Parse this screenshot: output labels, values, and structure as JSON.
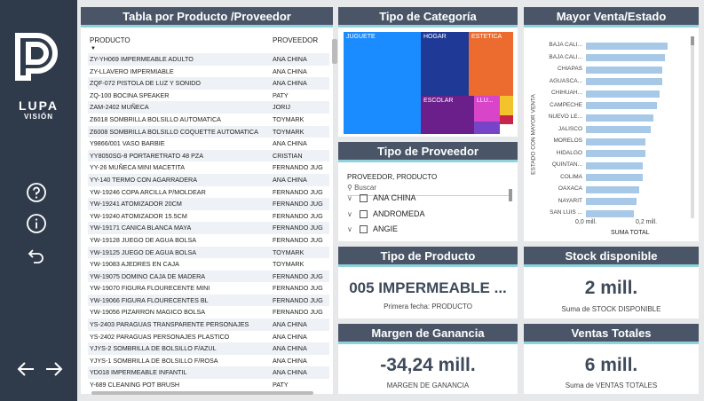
{
  "brand": {
    "line1": "LUPA",
    "line2": "VISIÓN"
  },
  "nav": {
    "help_icon": "question-circle-icon",
    "info_icon": "info-circle-icon",
    "back_icon": "undo-icon"
  },
  "table": {
    "title": "Tabla por Producto /Proveedor",
    "col_producto": "PRODUCTO",
    "col_proveedor": "PROVEEDOR",
    "rows": [
      [
        "ZY-YH069 IMPERMEABLE ADULTO",
        "ANA CHINA"
      ],
      [
        "ZY-LLAVERO IMPERMIABLE",
        "ANA CHINA"
      ],
      [
        "ZQF-072 PISTOLA DE LUZ Y SONIDO",
        "ANA CHINA"
      ],
      [
        "ZQ-100 BOCINA SPEAKER",
        "PATY"
      ],
      [
        "ZAM-2402 MUÑECA",
        "JORIJ"
      ],
      [
        "Z6018 SOMBRILLA BOLSILLO AUTOMATICA",
        "TOYMARK"
      ],
      [
        "Z6008 SOMBRILLA BOLSILLO COQUETTE AUTOMATICA",
        "TOYMARK"
      ],
      [
        "Y9866/001 VASO BARBIE",
        "ANA CHINA"
      ],
      [
        "YY8050SG-8 PORTARETRATO 48 PZA",
        "CRISTIAN"
      ],
      [
        "YY-26 MUÑECA MINI MACETITA",
        "FERNANDO JUG"
      ],
      [
        "YY-140 TERMO CON AGARRADERA",
        "ANA CHINA"
      ],
      [
        "YW-19246 COPA ARCILLA P/MOLDEAR",
        "FERNANDO JUG"
      ],
      [
        "YW-19241 ATOMIZADOR 20CM",
        "FERNANDO JUG"
      ],
      [
        "YW-19240 ATOMIZADOR 15.5CM",
        "FERNANDO JUG"
      ],
      [
        "YW-19171 CANICA BLANCA MAYA",
        "FERNANDO JUG"
      ],
      [
        "YW-19128 JUEGO DE AGUA BOLSA",
        "FERNANDO JUG"
      ],
      [
        "YW-19125 JUEGO DE AGUA BOLSA",
        "TOYMARK"
      ],
      [
        "YW-19083 AJEDRES EN CAJA",
        "TOYMARK"
      ],
      [
        "YW-19075 DOMINO CAJA DE MADERA",
        "FERNANDO JUG"
      ],
      [
        "YW-19070 FIGURA FLOURECENTE MINI",
        "FERNANDO JUG"
      ],
      [
        "YW-19066 FIGURA FLOURECENTES BL",
        "FERNANDO JUG"
      ],
      [
        "YW-19056 PIZARRON MAGICO BOLSA",
        "FERNANDO JUG"
      ],
      [
        "YS-2403 PARAGUAS TRANSPARENTE PERSONAJES",
        "ANA CHINA"
      ],
      [
        "YS-2402 PARAGUAS PERSONAJES PLASTICO",
        "ANA CHINA"
      ],
      [
        "YJYS-2 SOMBRILLA DE BOLSILLO F/AZUL",
        "ANA CHINA"
      ],
      [
        "YJYS-1 SOMBRILLA DE BOLSILLO F/ROSA",
        "ANA CHINA"
      ],
      [
        "YD018 IMPERMEABLE INFANTIL",
        "ANA CHINA"
      ],
      [
        "Y-689 CLEANING POT BRUSH",
        "PATY"
      ]
    ]
  },
  "categoria": {
    "title": "Tipo de Categoría",
    "tiles": [
      {
        "label": "JUGUETE",
        "color": "#1a8cff"
      },
      {
        "label": "HOGAR",
        "color": "#1f3a96"
      },
      {
        "label": "ESTETICA",
        "color": "#ec6b2f"
      },
      {
        "label": "ESCOLAR",
        "color": "#6b1f8a"
      },
      {
        "label": "LLU...",
        "color": "#d845c8"
      },
      {
        "label": "",
        "color": "#f2c32a"
      },
      {
        "label": "",
        "color": "#c9244a"
      },
      {
        "label": "",
        "color": "#7744c8"
      }
    ]
  },
  "proveedor": {
    "title": "Tipo de Proveedor",
    "header": "PROVEEDOR, PRODUCTO",
    "search_placeholder": "Buscar",
    "items": [
      "ANA CHINA",
      "ANDROMEDA",
      "ANGIE"
    ]
  },
  "estado": {
    "title": "Mayor Venta/Estado",
    "ylabel": "ESTADO CON MAYOR VENTA",
    "xlabel": "SUMA TOTAL",
    "ticks": [
      "0,0 mill.",
      "0,2 mill."
    ]
  },
  "chart_data": {
    "type": "bar",
    "categories": [
      "BAJA CALI...",
      "BAJA CALI...",
      "CHIAPAS",
      "AGUASCA...",
      "CHIHUAH...",
      "CAMPECHE",
      "NUEVO LE...",
      "JALISCO",
      "MORELOS",
      "HIDALGO",
      "QUINTAN...",
      "COLIMA",
      "OAXACA",
      "NAYARIT",
      "SAN LUIS ..."
    ],
    "values": [
      0.29,
      0.28,
      0.27,
      0.27,
      0.26,
      0.25,
      0.24,
      0.23,
      0.21,
      0.21,
      0.2,
      0.2,
      0.19,
      0.18,
      0.17
    ],
    "xlabel": "SUMA TOTAL",
    "ylabel": "ESTADO CON MAYOR VENTA",
    "xlim": [
      0,
      0.33
    ]
  },
  "kpis": {
    "producto": {
      "title": "Tipo de Producto",
      "value": "005 IMPERMEABLE ...",
      "sub": "Primera fecha: PRODUCTO"
    },
    "stock": {
      "title": "Stock disponible",
      "value": "2 mill.",
      "sub": "Suma de STOCK DISPONIBLE"
    },
    "margen": {
      "title": "Margen de Ganancia",
      "value": "-34,24 mill.",
      "sub": "MARGEN DE GANANCIA"
    },
    "ventas": {
      "title": "Ventas Totales",
      "value": "6 mill.",
      "sub": "Suma de VENTAS TOTALES"
    }
  }
}
